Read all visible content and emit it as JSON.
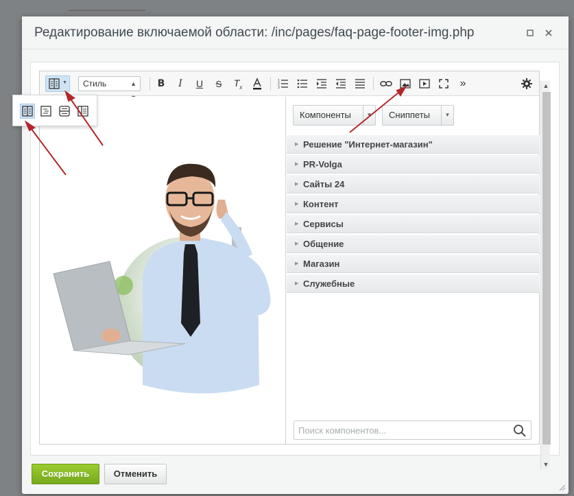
{
  "dialog": {
    "title": "Редактирование включаемой области: /inc/pages/faq-page-footer-img.php"
  },
  "toolbar": {
    "style_select": "Стиль"
  },
  "right_panel": {
    "components_button": "Компоненты",
    "snippets_button": "Сниппеты",
    "categories": [
      {
        "label": "Решение \"Интернет-магазин\""
      },
      {
        "label": "PR-Volga"
      },
      {
        "label": "Сайты 24"
      },
      {
        "label": "Контент"
      },
      {
        "label": "Сервисы"
      },
      {
        "label": "Общение"
      },
      {
        "label": "Магазин"
      },
      {
        "label": "Служебные"
      }
    ],
    "search_placeholder": "Поиск компонентов..."
  },
  "footer": {
    "save_label": "Сохранить",
    "cancel_label": "Отменить"
  },
  "colors": {
    "accent_green": "#86b925",
    "arrow_red": "#b3262a",
    "active_blue": "#cfe4f5"
  }
}
